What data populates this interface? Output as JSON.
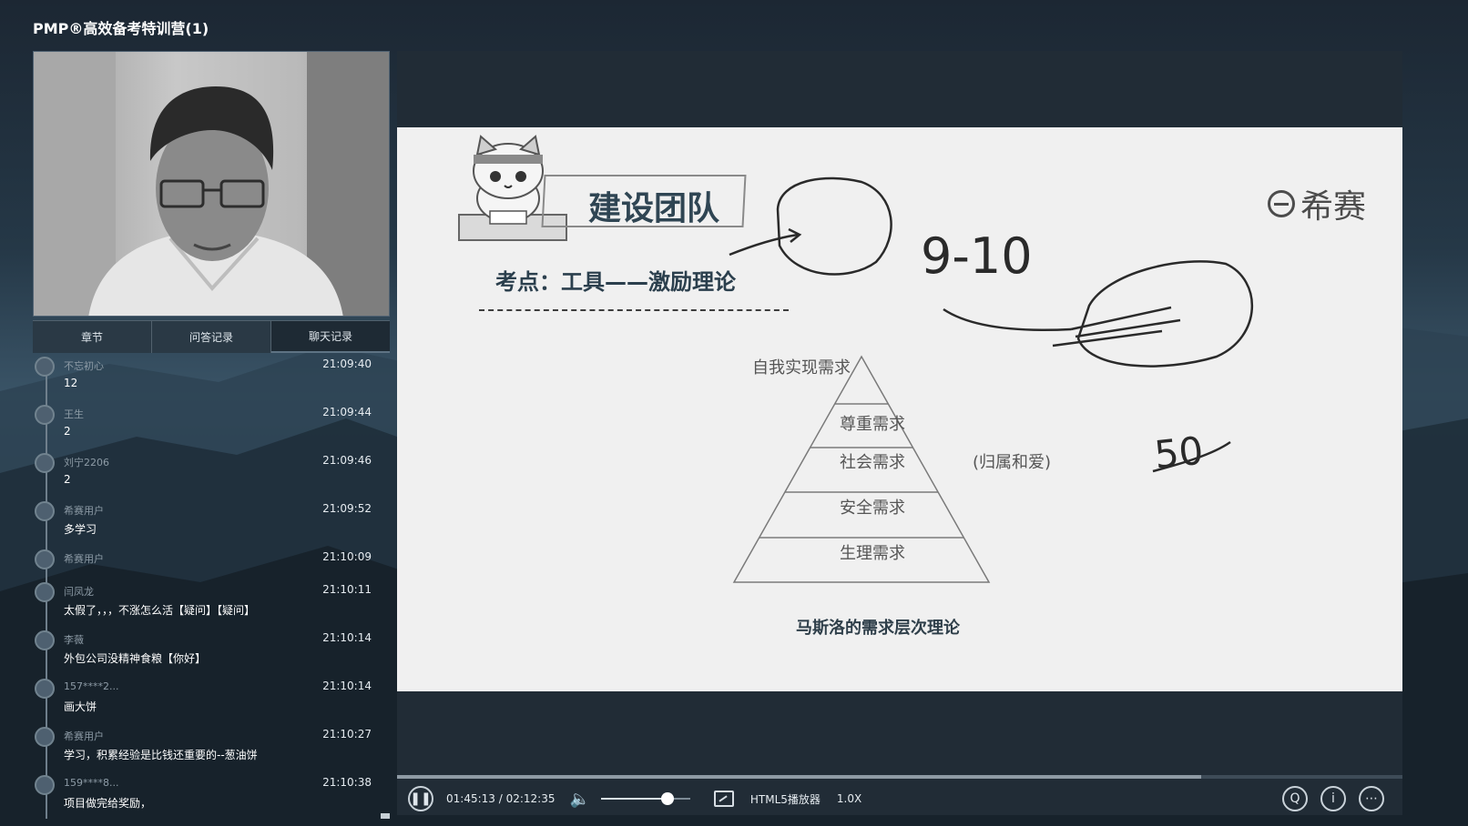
{
  "app": {
    "title": "PMP®高效备考特训营(1)"
  },
  "tabs": [
    {
      "label": "章节"
    },
    {
      "label": "问答记录"
    },
    {
      "label": "聊天记录"
    }
  ],
  "chat": [
    {
      "user": "不忘初心",
      "time": "21:09:40",
      "text": "12"
    },
    {
      "user": "王生",
      "time": "21:09:44",
      "text": "2"
    },
    {
      "user": "刘宁2206",
      "time": "21:09:46",
      "text": "2"
    },
    {
      "user": "希赛用户",
      "time": "21:09:52",
      "text": "多学习"
    },
    {
      "user": "希赛用户",
      "time": "21:10:09",
      "text": ""
    },
    {
      "user": "闫凤龙",
      "time": "21:10:11",
      "text": "太假了，，，不涨怎么活【疑问】【疑问】"
    },
    {
      "user": "李薇",
      "time": "21:10:14",
      "text": "外包公司没精神食粮【你好】"
    },
    {
      "user": "157****2...",
      "time": "21:10:14",
      "text": "画大饼"
    },
    {
      "user": "希赛用户",
      "time": "21:10:27",
      "text": "学习，积累经验是比钱还重要的--葱油饼"
    },
    {
      "user": "159****8...",
      "time": "21:10:38",
      "text": "项目做完给奖励，"
    }
  ],
  "slide": {
    "title": "建设团队",
    "brand": "希赛",
    "subtitle": "考点：工具——激励理论",
    "pyramid_levels": [
      "自我实现需求",
      "尊重需求",
      "社会需求",
      "安全需求",
      "生理需求"
    ],
    "side_note": "(归属和爱)",
    "caption": "马斯洛的需求层次理论",
    "handwriting": [
      "9-10",
      "50"
    ]
  },
  "player": {
    "time": "01:45:13 / 02:12:35",
    "progress": 0.8,
    "volume": 0.75,
    "player_label": "HTML5播放器",
    "speed": "1.0X",
    "icons": [
      "pause-icon",
      "volume-icon",
      "pip-icon",
      "subtitle-icon",
      "info-icon",
      "more-icon"
    ]
  }
}
